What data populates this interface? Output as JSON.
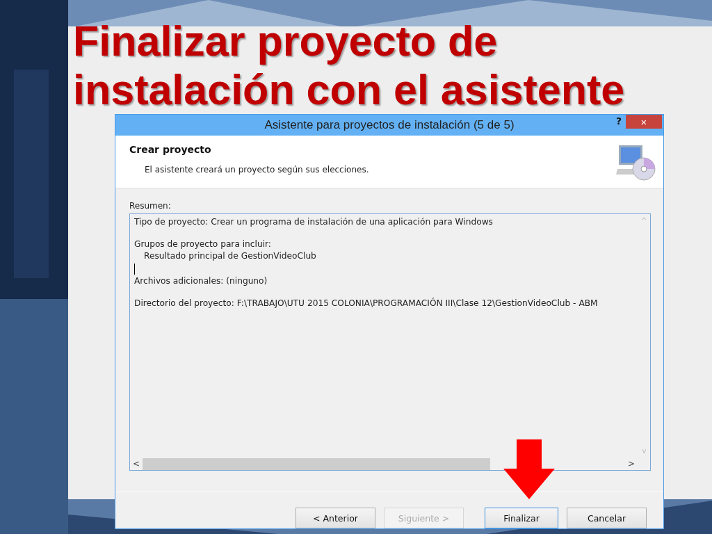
{
  "slide": {
    "title_lines": [
      "Finalizar proyecto de",
      "instalación con el asistente"
    ]
  },
  "window": {
    "title": "Asistente para proyectos de instalación (5 de 5)",
    "help": "?",
    "close": "×"
  },
  "header": {
    "heading": "Crear proyecto",
    "description": "El asistente creará un proyecto según sus elecciones."
  },
  "summary": {
    "label": "Resumen:",
    "entries": [
      {
        "text": "Tipo de proyecto: Crear un programa de instalación de una aplicación para Windows"
      },
      {
        "text": "Grupos de proyecto para incluir:",
        "children": [
          {
            "text": "Resultado principal de GestionVideoClub"
          }
        ]
      },
      {
        "text": "Archivos adicionales: (ninguno)"
      },
      {
        "text": "Directorio del proyecto: F:\\TRABAJO\\UTU 2015 COLONIA\\PROGRAMACIÓN III\\Clase 12\\GestionVideoClub - ABM"
      }
    ],
    "scroll_left": "<",
    "scroll_right": ">",
    "scroll_up": "^",
    "scroll_down": "v"
  },
  "buttons": [
    {
      "label": "< Anterior",
      "disabled": false,
      "default": false
    },
    {
      "label": "Siguiente >",
      "disabled": true,
      "default": false
    },
    {
      "label": "Finalizar",
      "disabled": false,
      "default": true
    },
    {
      "label": "Cancelar",
      "disabled": false,
      "default": false
    }
  ]
}
